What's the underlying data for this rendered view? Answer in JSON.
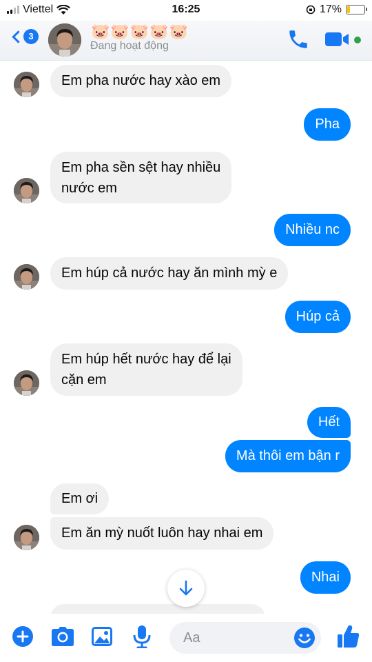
{
  "status_bar": {
    "carrier": "Viettel",
    "time": "16:25",
    "battery": "17%",
    "battery_level": 0.17
  },
  "header": {
    "back_badge": "3",
    "contact_name": "🐷🐷🐷🐷🐷",
    "status": "Đang hoạt động",
    "icons": [
      "back-chevron-icon",
      "phone-icon",
      "video-camera-icon"
    ],
    "accent_color": "#1877f2",
    "online_color": "#31a24c"
  },
  "messages": [
    {
      "from": "them",
      "text": "Em pha nước hay xào em"
    },
    {
      "from": "me",
      "text": "Pha"
    },
    {
      "from": "them",
      "lines": [
        "Em pha sền sệt hay nhiều",
        "nước em"
      ]
    },
    {
      "from": "me",
      "text": "Nhiều nc"
    },
    {
      "from": "them",
      "text": "Em húp cả nước hay ăn mình mỳ e"
    },
    {
      "from": "me",
      "text": "Húp cả"
    },
    {
      "from": "them",
      "lines": [
        "Em húp hết nước hay để lại",
        "cặn em"
      ]
    },
    {
      "from": "me",
      "text": "Hết"
    },
    {
      "from": "me",
      "text": "Mà thôi em bận r"
    },
    {
      "from": "them",
      "text": "Em ơi"
    },
    {
      "from": "them",
      "text": "Em ăn mỳ nuốt luôn hay nhai em"
    },
    {
      "from": "me",
      "text": "Nhai"
    }
  ],
  "colors": {
    "outgoing_bubble": "#0084ff",
    "incoming_bubble": "#f0f0f0"
  },
  "composer": {
    "placeholder": "Aa",
    "icons": [
      "plus-icon",
      "camera-icon",
      "image-icon",
      "microphone-icon",
      "emoji-icon",
      "thumbs-up-icon"
    ]
  }
}
